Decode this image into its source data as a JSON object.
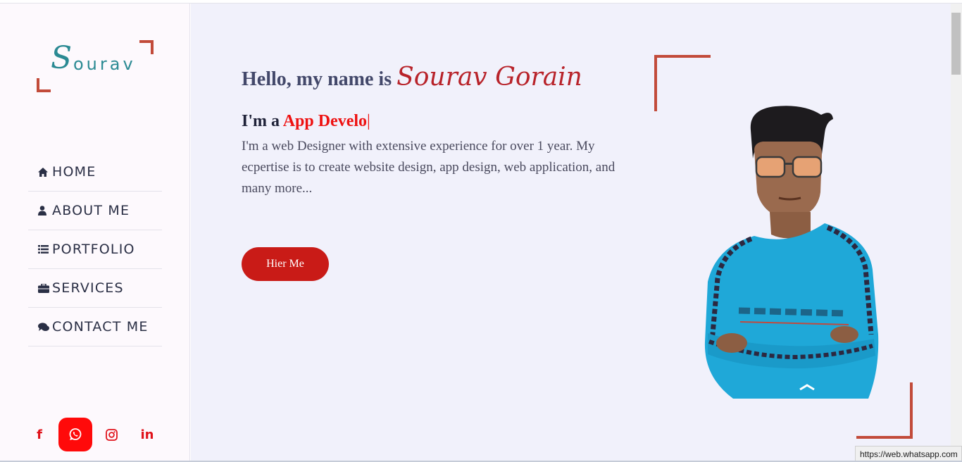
{
  "logo": {
    "initial": "S",
    "rest": "ourav"
  },
  "nav": [
    {
      "icon": "home-icon",
      "label": "HOME"
    },
    {
      "icon": "user-icon",
      "label": "ABOUT ME"
    },
    {
      "icon": "list-icon",
      "label": "PORTFOLIO"
    },
    {
      "icon": "briefcase-icon",
      "label": "SERVICES"
    },
    {
      "icon": "comments-icon",
      "label": "CONTACT ME"
    }
  ],
  "social": {
    "facebook": "f",
    "linkedin": "in"
  },
  "hero": {
    "greeting": "Hello, my name is",
    "name": "Sourav Gorain",
    "role_prefix": "I'm a",
    "role_typed": "App Develo",
    "caret": "|",
    "description": "I'm a web Designer with extensive experience for over 1 year. My ecpertise is to create website design, app design, web application, and many more...",
    "button": "Hier Me"
  },
  "status_bar": {
    "url": "https://web.whatsapp.com"
  },
  "colors": {
    "accent": "#c24b3a",
    "brand_teal": "#2b8a93",
    "button": "#c91b17",
    "highlight": "#ee1111",
    "background": "#f1f1fb"
  }
}
